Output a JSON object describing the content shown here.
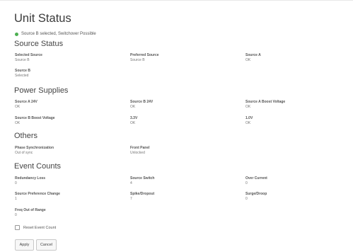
{
  "page_title": "Unit Status",
  "status_text": "Source B selected, Switchover Possible",
  "sections": {
    "source_status": {
      "title": "Source Status",
      "fields": [
        {
          "label": "Selected Source",
          "value": "Source B"
        },
        {
          "label": "Preferred Source",
          "value": "Source B"
        },
        {
          "label": "Source A",
          "value": "OK"
        },
        {
          "label": "Source B",
          "value": "Selected"
        }
      ]
    },
    "power_supplies": {
      "title": "Power Supplies",
      "fields": [
        {
          "label": "Source A 24V",
          "value": "OK"
        },
        {
          "label": "Source B 24V",
          "value": "OK"
        },
        {
          "label": "Source A Boost Voltage",
          "value": "OK"
        },
        {
          "label": "Source B Boost Voltage",
          "value": "OK"
        },
        {
          "label": "3.3V",
          "value": "OK"
        },
        {
          "label": "1.0V",
          "value": "OK"
        }
      ]
    },
    "others": {
      "title": "Others",
      "fields": [
        {
          "label": "Phase Synchronization",
          "value": "Out of sync"
        },
        {
          "label": "Front Panel",
          "value": "Unlocked"
        }
      ]
    },
    "event_counts": {
      "title": "Event Counts",
      "fields": [
        {
          "label": "Redundancy Loss",
          "value": "0"
        },
        {
          "label": "Source Switch",
          "value": "4"
        },
        {
          "label": "Over Current",
          "value": "0"
        },
        {
          "label": "Source Preference Change",
          "value": "1"
        },
        {
          "label": "Spike/Dropout",
          "value": "7"
        },
        {
          "label": "Surge/Droop",
          "value": "0"
        },
        {
          "label": "Freq Out of Range",
          "value": "0"
        }
      ]
    }
  },
  "reset_checkbox_label": "Reset Event Count",
  "buttons": {
    "apply": "Apply",
    "cancel": "Cancel"
  },
  "colors": {
    "ok_status": "#4caf50"
  }
}
